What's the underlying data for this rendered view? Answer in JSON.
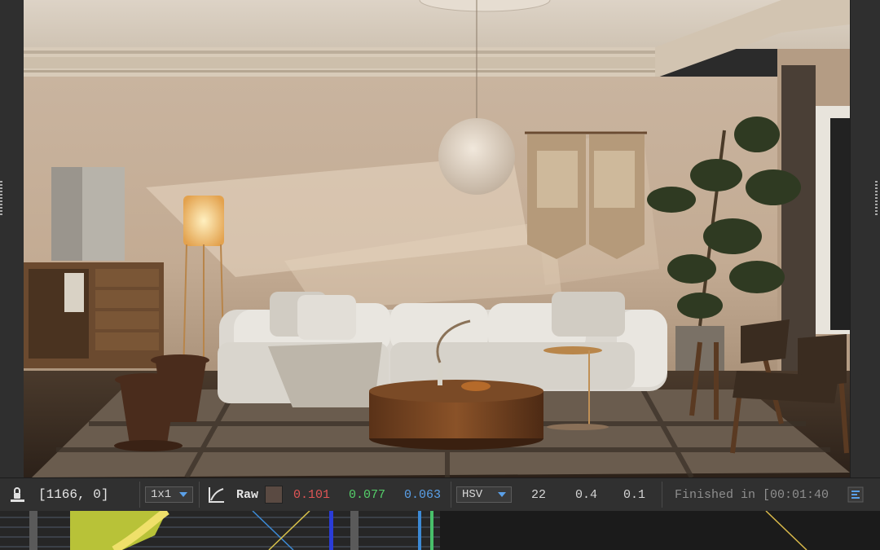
{
  "statusbar": {
    "lock_icon": "pin-lock-icon",
    "pixel_coords": "[1166, 0]",
    "sample_size": "1x1",
    "curve_icon": "curve-icon",
    "mode": "Raw",
    "swatch_color": "#5a4a42",
    "r": "0.101",
    "g": "0.077",
    "b": "0.063",
    "color_space": "HSV",
    "h": "22",
    "s": "0.4",
    "v": "0.1",
    "render_status": "Finished in [00:01:40",
    "menu_icon": "panel-menu-icon"
  },
  "colors": {
    "red": "#e05555",
    "green": "#55d06a",
    "blue": "#5aa0e8"
  }
}
